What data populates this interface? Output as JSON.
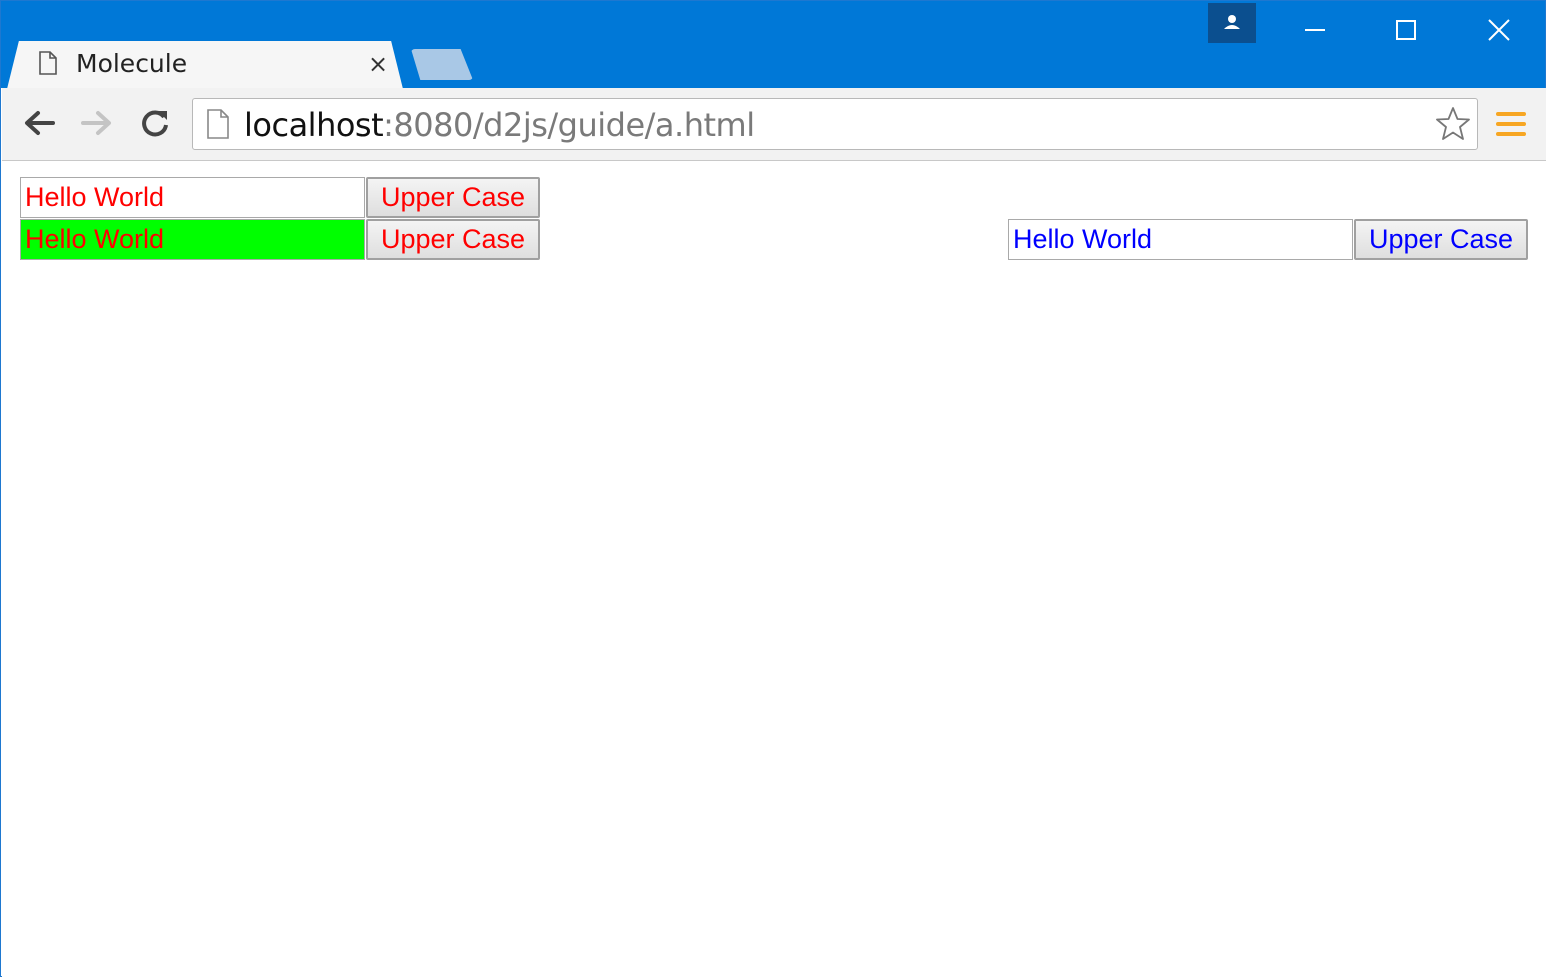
{
  "browser": {
    "tab": {
      "title": "Molecule",
      "close_glyph": "×"
    },
    "address_bar": {
      "host": "localhost",
      "rest": ":8080/d2js/guide/a.html"
    },
    "icons": {
      "tab_page": "page-icon",
      "close": "close-icon",
      "new_tab": "new-tab-icon",
      "profile": "profile-icon",
      "minimize": "minimize-icon",
      "maximize": "maximize-icon",
      "window_close": "close-icon",
      "back": "back-arrow-icon",
      "forward": "forward-arrow-icon",
      "reload": "reload-icon",
      "bookmark": "star-icon",
      "menu": "hamburger-menu-icon"
    }
  },
  "page": {
    "rows": [
      {
        "input_value": "Hello World",
        "button_label": "Upper Case",
        "text_color": "#ff0000",
        "input_bg": "#ffffff"
      },
      {
        "input_value": "Hello World",
        "button_label": "Upper Case",
        "text_color": "#ff0000",
        "input_bg": "#00ff00"
      },
      {
        "input_value": "Hello World",
        "button_label": "Upper Case",
        "text_color": "#0000ff",
        "input_bg": "#ffffff"
      }
    ]
  },
  "colors": {
    "titlebar": "#0078d7",
    "menu_accent": "#f7a623"
  }
}
